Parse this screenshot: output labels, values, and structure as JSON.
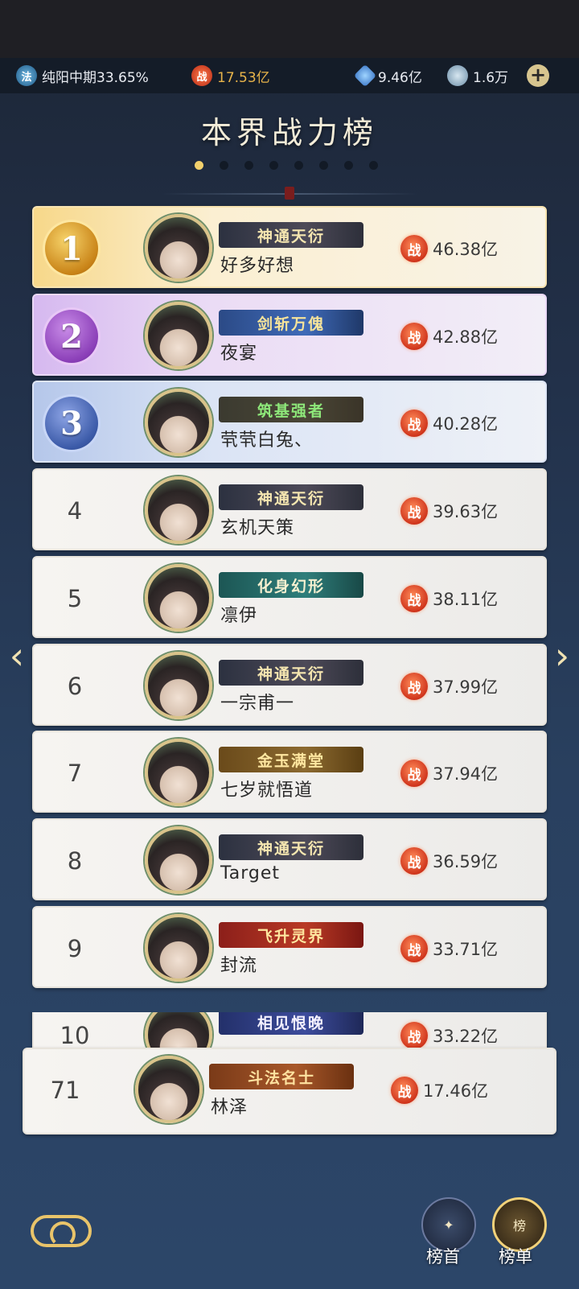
{
  "status": {
    "realm": "纯阳中期33.65%",
    "power": "17.53亿",
    "crystals": "9.46亿",
    "coins": "1.6万",
    "realm_icon": "法",
    "power_icon": "战"
  },
  "title": "本界战力榜",
  "pager": {
    "total": 8,
    "active": 0
  },
  "power_badge": "战",
  "rows": [
    {
      "rank": "1",
      "title": "神通天衍",
      "name": "好多好想",
      "power": "46.38亿"
    },
    {
      "rank": "2",
      "title": "剑斩万傀",
      "name": "夜宴",
      "power": "42.88亿"
    },
    {
      "rank": "3",
      "title": "筑基强者",
      "name": "茕茕白兔、",
      "power": "40.28亿"
    },
    {
      "rank": "4",
      "title": "神通天衍",
      "name": "玄机天策",
      "power": "39.63亿"
    },
    {
      "rank": "5",
      "title": "化身幻形",
      "name": "凛伊",
      "power": "38.11亿"
    },
    {
      "rank": "6",
      "title": "神通天衍",
      "name": "一宗甫一",
      "power": "37.99亿"
    },
    {
      "rank": "7",
      "title": "金玉满堂",
      "name": "七岁就悟道",
      "power": "37.94亿"
    },
    {
      "rank": "8",
      "title": "神通天衍",
      "name": "Target",
      "power": "36.59亿"
    },
    {
      "rank": "9",
      "title": "飞升灵界",
      "name": "封流",
      "power": "33.71亿"
    },
    {
      "rank": "10",
      "title": "相见恨晚",
      "name": "",
      "power": "33.22亿"
    }
  ],
  "self": {
    "rank": "71",
    "title": "斗法名士",
    "name": "林泽",
    "power": "17.46亿"
  },
  "bottom": {
    "top_label": "榜首",
    "list_label": "榜单",
    "list_glyph": "榜"
  }
}
